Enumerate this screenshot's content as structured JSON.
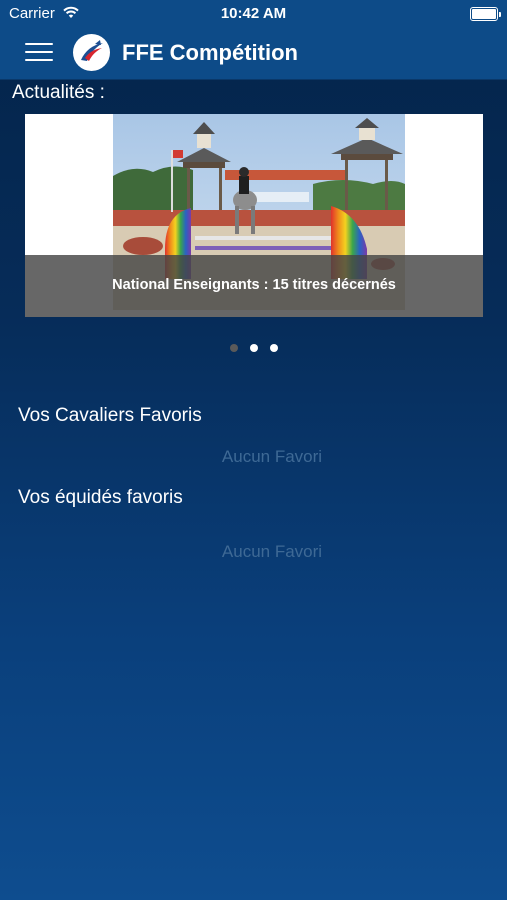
{
  "status_bar": {
    "carrier": "Carrier",
    "time": "10:42 AM"
  },
  "header": {
    "title": "FFE Compétition"
  },
  "news": {
    "label": "Actualités :",
    "slide_caption": "National Enseignants : 15 titres décernés",
    "slide_count": 3,
    "active_slide": 1
  },
  "favorite_riders": {
    "label": "Vos Cavaliers Favoris",
    "empty_text": "Aucun Favori"
  },
  "favorite_horses": {
    "label": "Vos équidés favoris",
    "empty_text": "Aucun Favori"
  },
  "colors": {
    "bar": "#0d4b88",
    "empty_text": "#3e6995",
    "dot_active": "#5a5a5a",
    "dot_inactive": "#ffffff"
  }
}
